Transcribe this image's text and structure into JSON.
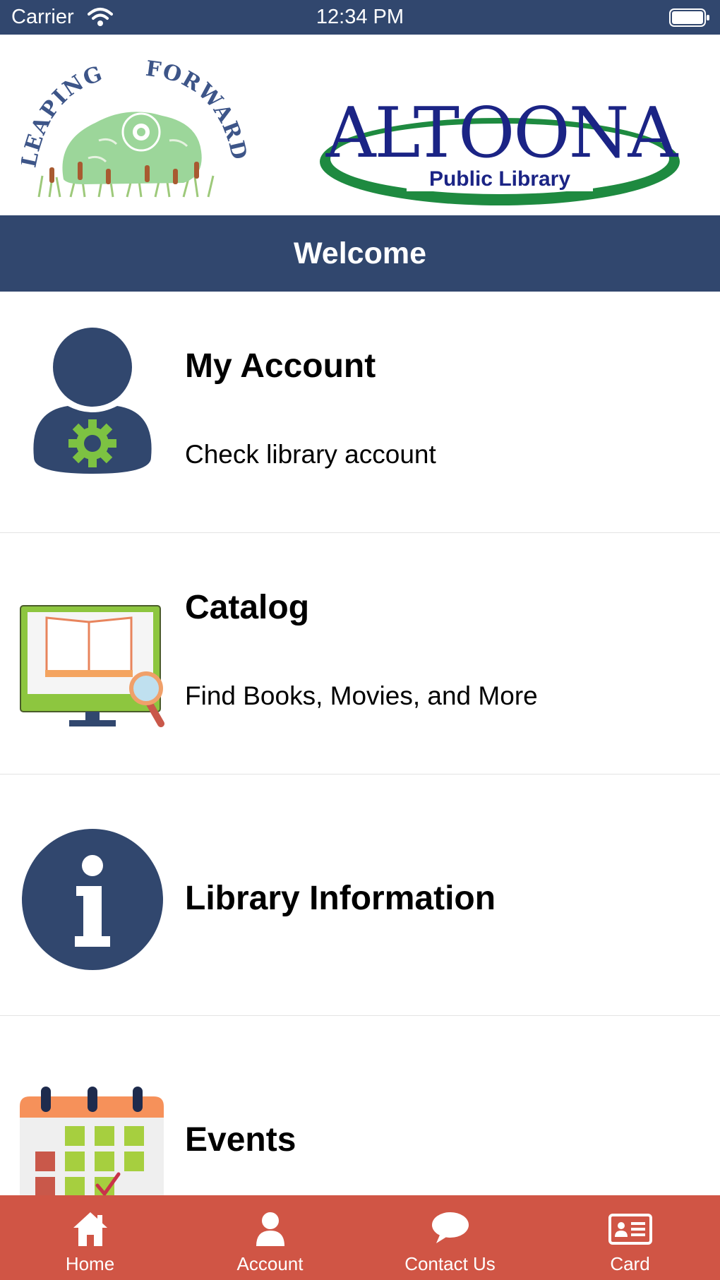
{
  "status_bar": {
    "carrier": "Carrier",
    "time": "12:34 PM"
  },
  "header": {
    "logo_left_text": "LEAPING FORWARD",
    "logo_right_title": "ALTOONA",
    "logo_right_subtitle": "Public Library"
  },
  "welcome": {
    "title": "Welcome"
  },
  "menu": [
    {
      "title": "My Account",
      "subtitle": "Check library account",
      "icon": "account-icon"
    },
    {
      "title": "Catalog",
      "subtitle": "Find Books, Movies, and More",
      "icon": "catalog-icon"
    },
    {
      "title": "Library Information",
      "subtitle": "",
      "icon": "info-icon"
    },
    {
      "title": "Events",
      "subtitle": "",
      "icon": "calendar-icon"
    }
  ],
  "tab_bar": [
    {
      "label": "Home",
      "icon": "home-icon"
    },
    {
      "label": "Account",
      "icon": "person-icon"
    },
    {
      "label": "Contact Us",
      "icon": "chat-bubble-icon"
    },
    {
      "label": "Card",
      "icon": "id-card-icon"
    }
  ],
  "colors": {
    "navy": "#31476e",
    "tab_bar": "#d05545",
    "gear_green": "#7dc242",
    "altoona_blue": "#1b2485",
    "altoona_green": "#1e8a40"
  }
}
